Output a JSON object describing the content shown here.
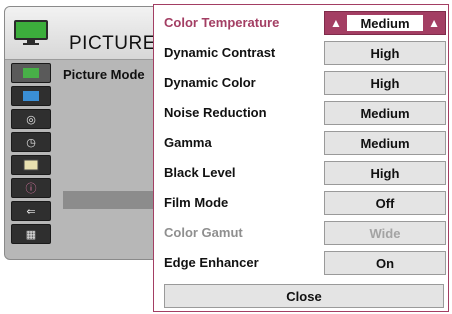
{
  "back_menu": {
    "title": "PICTURE",
    "item": "Picture Mode",
    "icons": [
      "picture-icon",
      "screen-icon",
      "audio-icon",
      "time-icon",
      "options-icon",
      "info-icon",
      "input-icon",
      "media-icon"
    ]
  },
  "submenu": {
    "rows": [
      {
        "label": "Color Temperature",
        "value": "Medium"
      },
      {
        "label": "Dynamic Contrast",
        "value": "High"
      },
      {
        "label": "Dynamic Color",
        "value": "High"
      },
      {
        "label": "Noise Reduction",
        "value": "Medium"
      },
      {
        "label": "Gamma",
        "value": "Medium"
      },
      {
        "label": "Black Level",
        "value": "High"
      },
      {
        "label": "Film Mode",
        "value": "Off"
      },
      {
        "label": "Color Gamut",
        "value": "Wide"
      },
      {
        "label": "Edge Enhancer",
        "value": "On"
      }
    ],
    "close_label": "Close",
    "selected_index": 0,
    "disabled_index": 7
  },
  "colors": {
    "accent": "#a33e63",
    "panel_gray": "#b7b7b7",
    "value_bg": "#e4e4e4"
  }
}
